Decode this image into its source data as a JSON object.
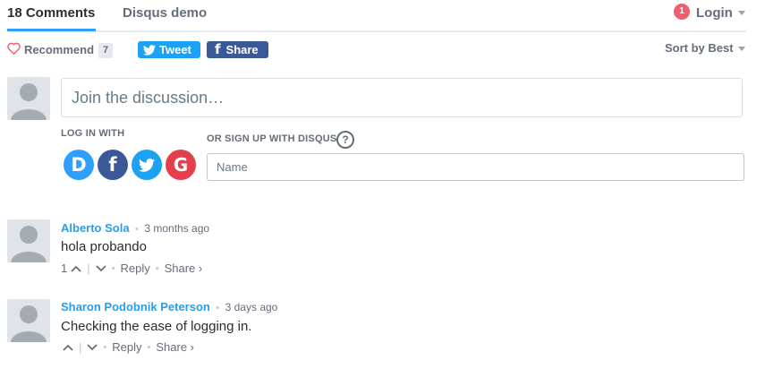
{
  "nav": {
    "comments_tab": "18 Comments",
    "community_tab": "Disqus demo",
    "notification_count": "1",
    "login_label": "Login"
  },
  "toolbar": {
    "recommend_label": "Recommend",
    "recommend_count": "7",
    "tweet_label": "Tweet",
    "share_label": "Share",
    "sort_label": "Sort by Best"
  },
  "composer": {
    "placeholder": "Join the discussion…",
    "login_with_label": "LOG IN WITH",
    "signup_label": "OR SIGN UP WITH DISQUS",
    "help_label": "?",
    "name_placeholder": "Name",
    "providers": [
      "disqus-icon",
      "facebook-icon",
      "twitter-icon",
      "google-icon"
    ]
  },
  "posts": [
    {
      "author": "Alberto Sola",
      "time": "3 months ago",
      "body": "hola probando",
      "votes": "1",
      "reply_label": "Reply",
      "share_label": "Share ›"
    },
    {
      "author": "Sharon Podobnik Peterson",
      "time": "3 days ago",
      "body": "Checking the ease of logging in.",
      "votes": "",
      "reply_label": "Reply",
      "share_label": "Share ›"
    }
  ],
  "colors": {
    "accent": "#2e9fff",
    "twitter": "#1da1f2",
    "facebook": "#3b5998",
    "disqus": "#2e9fff",
    "google": "#dd4b39",
    "badge": "#f05f70"
  }
}
